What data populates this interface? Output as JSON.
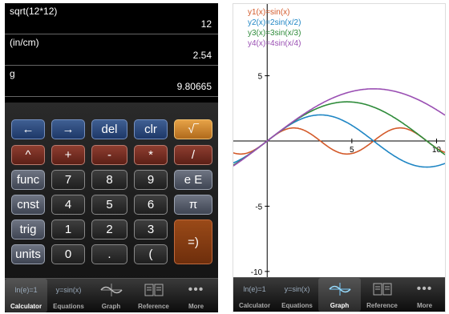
{
  "calculator": {
    "history": [
      {
        "expr": "sqrt(12*12)",
        "result": "12"
      },
      {
        "expr": "(in/cm)",
        "result": "2.54"
      },
      {
        "expr": "g",
        "result": "9.80665"
      }
    ],
    "keys": {
      "left_arrow": "←",
      "right_arrow": "→",
      "del": "del",
      "clr": "clr",
      "sqrt": "√‾",
      "pow": "^",
      "plus": "+",
      "minus": "-",
      "times": "*",
      "divide": "/",
      "func": "func",
      "seven": "7",
      "eight": "8",
      "nine": "9",
      "exp": "e E",
      "cnst": "cnst",
      "four": "4",
      "five": "5",
      "six": "6",
      "pi": "π",
      "trig": "trig",
      "one": "1",
      "two": "2",
      "three": "3",
      "close_paren": "=)",
      "units": "units",
      "zero": "0",
      "dot": ".",
      "open_paren": "("
    }
  },
  "tabbar_left": {
    "tabs": [
      {
        "label": "Calculator",
        "icon_text": "ln(e)=1",
        "active": true
      },
      {
        "label": "Equations",
        "icon_text": "y=sin(x)",
        "active": false
      },
      {
        "label": "Graph",
        "active": false
      },
      {
        "label": "Reference",
        "active": false
      },
      {
        "label": "More",
        "active": false
      }
    ]
  },
  "tabbar_right": {
    "tabs": [
      {
        "label": "Calculator",
        "icon_text": "ln(e)=1",
        "active": false
      },
      {
        "label": "Equations",
        "icon_text": "y=sin(x)",
        "active": false
      },
      {
        "label": "Graph",
        "active": true
      },
      {
        "label": "Reference",
        "active": false
      },
      {
        "label": "More",
        "active": false
      }
    ]
  },
  "chart_data": {
    "type": "line",
    "xlim": [
      -2,
      10.5
    ],
    "ylim": [
      -10.5,
      10.5
    ],
    "x_ticks": [
      "5",
      "10"
    ],
    "y_ticks": [
      "5",
      "-5",
      "-10"
    ],
    "grid": false,
    "legend_placement": "top-left",
    "series": [
      {
        "name": "y1(x)=sin(x)",
        "color": "#d35a2a",
        "amplitude": 1,
        "period_factor": 1
      },
      {
        "name": "y2(x)=2sin(x/2)",
        "color": "#1f86c4",
        "amplitude": 2,
        "period_factor": 0.5
      },
      {
        "name": "y3(x)=3sin(x/3)",
        "color": "#2e8b3a",
        "amplitude": 3,
        "period_factor": 0.3333
      },
      {
        "name": "y4(x)=4sin(x/4)",
        "color": "#9a4fb3",
        "amplitude": 4,
        "period_factor": 0.25
      }
    ]
  }
}
